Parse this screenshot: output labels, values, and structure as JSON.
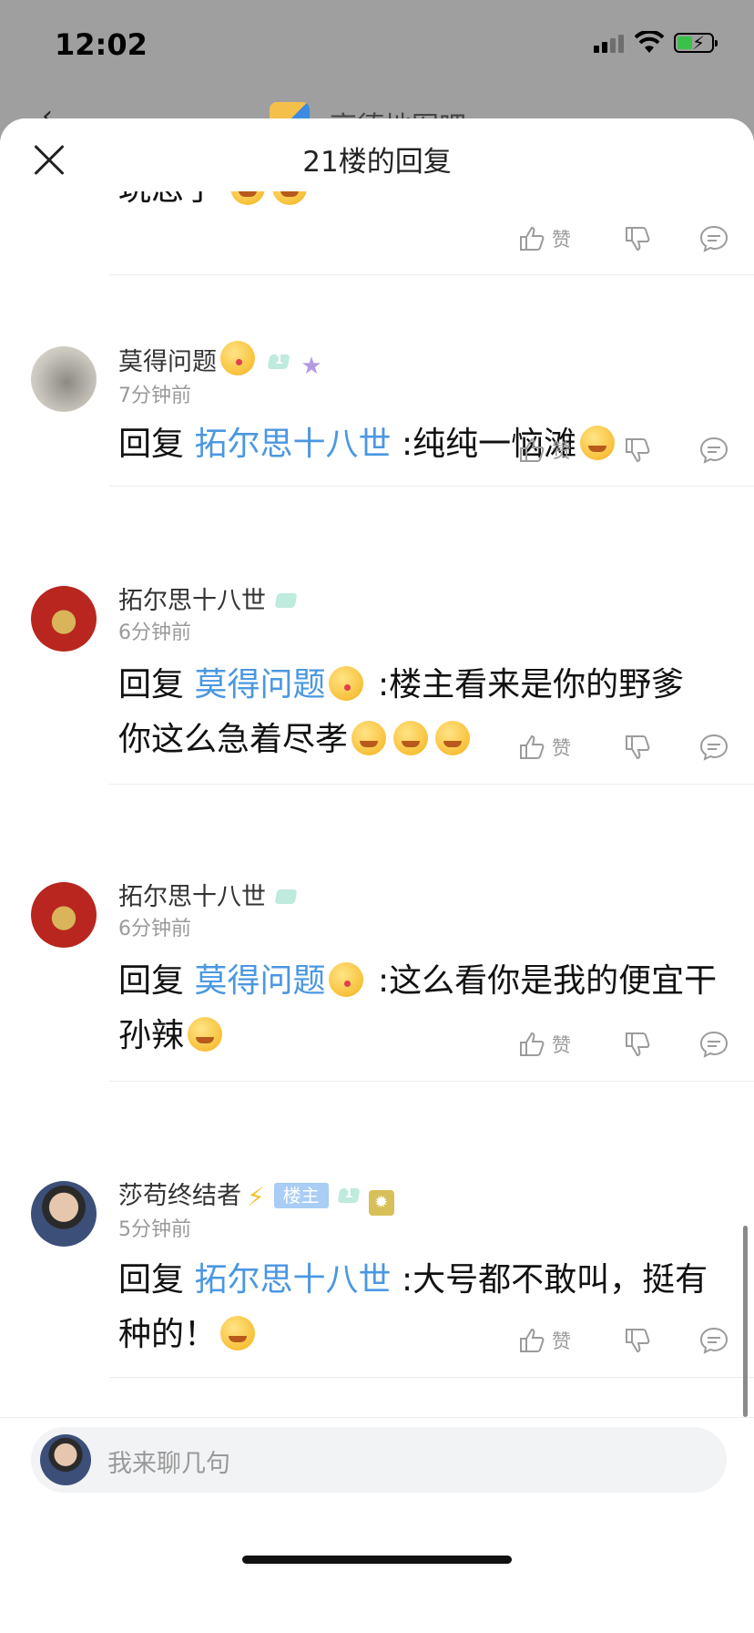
{
  "status_bar": {
    "time": "12:02"
  },
  "background_page": {
    "title": "高德地图吧"
  },
  "sheet": {
    "title": "21楼的回复",
    "first_fragment": {
      "text": "玩怂了"
    },
    "action_labels": {
      "like": "赞"
    },
    "replies": [
      {
        "user": "莫得问题",
        "time": "7分钟前",
        "level": "1",
        "reply_prefix": "回复",
        "reply_to": "拓尔思十八世",
        "text": ":纯纯一恼滩"
      },
      {
        "user": "拓尔思十八世",
        "time": "6分钟前",
        "reply_prefix": "回复",
        "reply_to": "莫得问题",
        "text": ":楼主看来是你的野爹 你这么急着尽孝"
      },
      {
        "user": "拓尔思十八世",
        "time": "6分钟前",
        "reply_prefix": "回复",
        "reply_to": "莫得问题",
        "text": ":这么看你是我的便宜干孙辣"
      },
      {
        "user": "莎苟终结者",
        "time": "5分钟前",
        "owner_badge": "楼主",
        "level": "1",
        "reply_prefix": "回复",
        "reply_to": "拓尔思十八世",
        "text": ":大号都不敢叫，挺有种的！"
      }
    ]
  },
  "footer": {
    "input_placeholder": "我来聊几句"
  },
  "colors": {
    "link": "#4a97e2",
    "owner_badge": "#a9cdf5"
  }
}
